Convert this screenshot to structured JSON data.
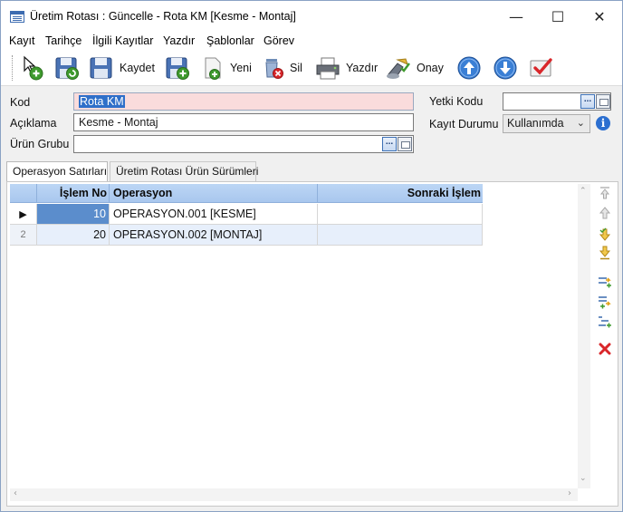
{
  "window": {
    "title": "Üretim Rotası : Güncelle - Rota KM [Kesme - Montaj]",
    "icon": "form-window-icon",
    "controls": {
      "minimize": "—",
      "maximize": "☐",
      "close": "✕"
    }
  },
  "menu": [
    "Kayıt",
    "Tarihçe",
    "İlgili Kayıtlar",
    "Yazdır",
    "Şablonlar",
    "Görev"
  ],
  "toolbar": {
    "new_record_icon": "new-record-icon",
    "save_refresh_icon": "save-refresh-icon",
    "save_label": "Kaydet",
    "save_new_label": "Yeni",
    "delete_label": "Sil",
    "print_label": "Yazdır",
    "approve_label": "Onay",
    "prev_icon": "arrow-up-icon",
    "next_icon": "arrow-down-icon",
    "check_icon": "approve-check-icon"
  },
  "form": {
    "kod_label": "Kod",
    "kod_value": "Rota KM",
    "aciklama_label": "Açıklama",
    "aciklama_value": "Kesme - Montaj",
    "urun_grubu_label": "Ürün Grubu",
    "urun_grubu_value": "",
    "yetki_kodu_label": "Yetki Kodu",
    "yetki_kodu_value": "",
    "kayit_durumu_label": "Kayıt Durumu",
    "kayit_durumu_value": "Kullanımda",
    "ellipsis": "..."
  },
  "tabs": [
    "Operasyon Satırları",
    "Üretim Rotası Ürün Sürümleri"
  ],
  "grid": {
    "columns": [
      "İşlem No",
      "Operasyon",
      "Sonraki İşlem"
    ],
    "rows": [
      {
        "marker": "▶",
        "islem_no": "10",
        "operasyon": "OPERASYON.001 [KESME]",
        "sonraki": ""
      },
      {
        "marker": "2",
        "islem_no": "20",
        "operasyon": "OPERASYON.002 [MONTAJ]",
        "sonraki": ""
      }
    ]
  },
  "colors": {
    "header_blue": "#a9c7ee",
    "selected_cell": "#5b8dcc",
    "kod_background": "#fadcdc",
    "delete_red": "#d9262a"
  }
}
